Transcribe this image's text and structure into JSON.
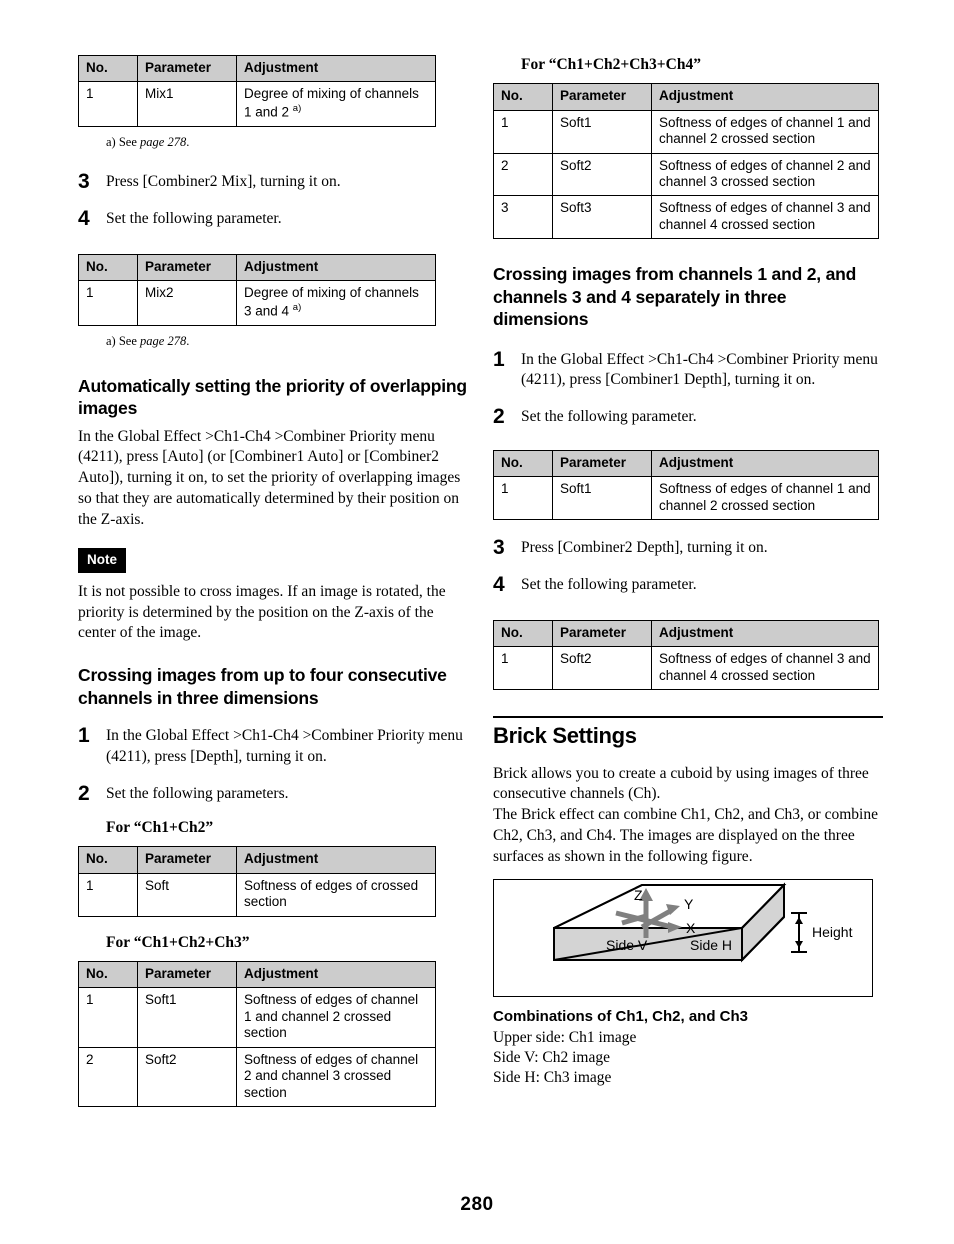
{
  "page_number": "280",
  "tables": {
    "headers": [
      "No.",
      "Parameter",
      "Adjustment"
    ],
    "mix1": {
      "rows": [
        {
          "no": "1",
          "parameter": "Mix1",
          "adjustment": "Degree of mixing of channels 1 and 2 ",
          "sup": "a)"
        }
      ]
    },
    "mix2": {
      "rows": [
        {
          "no": "1",
          "parameter": "Mix2",
          "adjustment": "Degree of mixing of channels 3 and 4 ",
          "sup": "a)"
        }
      ]
    },
    "ch1ch2": {
      "rows": [
        {
          "no": "1",
          "parameter": "Soft",
          "adjustment": "Softness of edges of crossed section"
        }
      ]
    },
    "ch1ch2ch3": {
      "rows": [
        {
          "no": "1",
          "parameter": "Soft1",
          "adjustment": "Softness of edges of channel 1 and channel 2 crossed section"
        },
        {
          "no": "2",
          "parameter": "Soft2",
          "adjustment": "Softness of edges of channel 2 and channel 3 crossed section"
        }
      ]
    },
    "ch1ch2ch3ch4": {
      "rows": [
        {
          "no": "1",
          "parameter": "Soft1",
          "adjustment": "Softness of edges of channel 1 and channel 2 crossed section"
        },
        {
          "no": "2",
          "parameter": "Soft2",
          "adjustment": "Softness of edges of channel 2 and channel 3 crossed section"
        },
        {
          "no": "3",
          "parameter": "Soft3",
          "adjustment": "Softness of edges of channel 3 and channel 4 crossed section"
        }
      ]
    },
    "combiner1_depth": {
      "rows": [
        {
          "no": "1",
          "parameter": "Soft1",
          "adjustment": "Softness of edges of channel 1 and channel 2 crossed section"
        }
      ]
    },
    "combiner2_depth": {
      "rows": [
        {
          "no": "1",
          "parameter": "Soft2",
          "adjustment": "Softness of edges of channel 3 and channel 4 crossed section"
        }
      ]
    }
  },
  "left_column": {
    "footnote_1": {
      "prefix": "a) See ",
      "italic": "page 278",
      "suffix": "."
    },
    "step_3": {
      "num": "3",
      "text": "Press [Combiner2 Mix], turning it on."
    },
    "step_4": {
      "num": "4",
      "text": "Set the following parameter."
    },
    "footnote_2": {
      "prefix": "a) See ",
      "italic": "page 278",
      "suffix": "."
    },
    "auto_priority": {
      "heading": "Automatically setting the priority of overlapping images",
      "paragraph": "In the Global Effect >Ch1-Ch4 >Combiner Priority menu (4211), press [Auto] (or [Combiner1 Auto] or [Combiner2 Auto]), turning it on, to set the priority of overlapping images so that they are automatically determined by their position on the Z-axis."
    },
    "note": {
      "label": "Note",
      "text": "It is not possible to cross images. If an image is rotated, the priority is determined by the position on the Z-axis of the center of the image."
    },
    "crossing_four": {
      "heading": "Crossing images from up to four consecutive channels in three dimensions",
      "step_1": {
        "num": "1",
        "text": "In the Global Effect >Ch1-Ch4 >Combiner Priority menu (4211), press [Depth], turning it on."
      },
      "step_2": {
        "num": "2",
        "text": "Set the following parameters."
      },
      "caption_ch1ch2": "For “Ch1+Ch2”",
      "caption_ch1ch2ch3": "For “Ch1+Ch2+Ch3”"
    }
  },
  "right_column": {
    "caption_ch1ch2ch3ch4": "For “Ch1+Ch2+Ch3+Ch4”",
    "crossing_separately": {
      "heading": "Crossing images from channels 1 and 2, and channels 3 and 4 separately in three dimensions",
      "step_1": {
        "num": "1",
        "text": "In the Global Effect >Ch1-Ch4 >Combiner Priority menu (4211), press [Combiner1 Depth], turning it on."
      },
      "step_2": {
        "num": "2",
        "text": "Set the following parameter."
      },
      "step_3": {
        "num": "3",
        "text": "Press [Combiner2 Depth], turning it on."
      },
      "step_4": {
        "num": "4",
        "text": "Set the following parameter."
      }
    },
    "brick": {
      "heading": "Brick Settings",
      "paragraph_1": "Brick allows you to create a cuboid by using images of three consecutive channels (Ch).",
      "paragraph_2": "The Brick effect can combine Ch1, Ch2, and Ch3, or combine Ch2, Ch3, and Ch4. The images are displayed on the three surfaces as shown in the following figure.",
      "figure": {
        "axis_z": "Z",
        "axis_y": "Y",
        "axis_x": "X",
        "face_side_v": "Side V",
        "face_side_h": "Side H",
        "dimension_label": "Height"
      },
      "combinations_heading": "Combinations of Ch1, Ch2, and Ch3",
      "combination_lines": [
        "Upper side: Ch1 image",
        "Side V: Ch2 image",
        "Side H: Ch3 image"
      ]
    }
  },
  "colors": {
    "table_header_bg": "#cccccc",
    "figure_face_fill": "#d4d4d4",
    "figure_axis": "#808080",
    "text": "#000000"
  }
}
